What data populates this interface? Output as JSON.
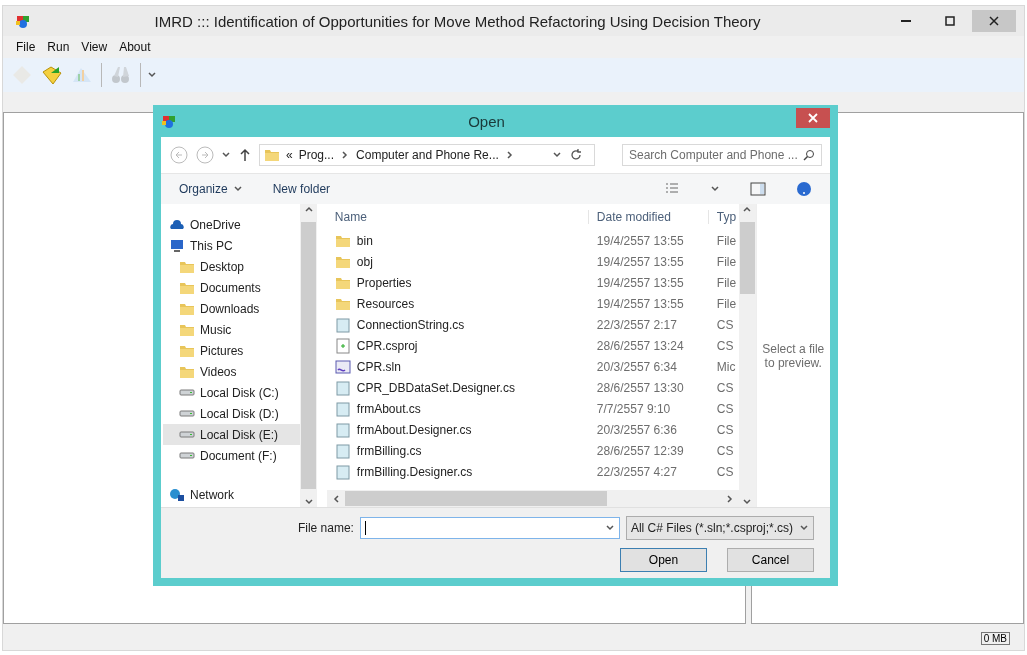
{
  "window": {
    "title": "IMRD ::: Identification of Opportunities for Move Method Refactoring Using Decision Theory"
  },
  "menu": [
    "File",
    "Run",
    "View",
    "About"
  ],
  "toolbar": [
    {
      "kind": "new",
      "disabled": true
    },
    {
      "kind": "open",
      "disabled": false
    },
    {
      "kind": "chart",
      "disabled": true
    },
    {
      "kind": "find",
      "disabled": true
    }
  ],
  "dialog": {
    "title": "Open",
    "address": {
      "prefix": "«",
      "crumbs": [
        "Prog...",
        "Computer and Phone Re..."
      ]
    },
    "search": {
      "placeholder": "Search Computer and Phone ..."
    },
    "commands": [
      "Organize",
      "New folder"
    ],
    "nav": [
      {
        "label": "OneDrive",
        "kind": "cloud",
        "selected": false
      },
      {
        "label": "This PC",
        "kind": "pc",
        "selected": false,
        "children": [
          {
            "label": "Desktop",
            "kind": "folder",
            "selected": false
          },
          {
            "label": "Documents",
            "kind": "folder",
            "selected": false
          },
          {
            "label": "Downloads",
            "kind": "folder",
            "selected": false
          },
          {
            "label": "Music",
            "kind": "folder",
            "selected": false
          },
          {
            "label": "Pictures",
            "kind": "folder",
            "selected": false
          },
          {
            "label": "Videos",
            "kind": "folder",
            "selected": false
          },
          {
            "label": "Local Disk (C:)",
            "kind": "drive",
            "selected": false
          },
          {
            "label": "Local Disk (D:)",
            "kind": "drive",
            "selected": false
          },
          {
            "label": "Local Disk (E:)",
            "kind": "drive",
            "selected": true
          },
          {
            "label": "Document (F:)",
            "kind": "drive",
            "selected": false
          }
        ]
      },
      {
        "label": "Network",
        "kind": "network",
        "selected": false
      }
    ],
    "columns": [
      "Name",
      "Date modified",
      "Typ"
    ],
    "files": [
      {
        "name": "bin",
        "date": "19/4/2557 13:55",
        "type": "File",
        "kind": "folder"
      },
      {
        "name": "obj",
        "date": "19/4/2557 13:55",
        "type": "File",
        "kind": "folder"
      },
      {
        "name": "Properties",
        "date": "19/4/2557 13:55",
        "type": "File",
        "kind": "folder"
      },
      {
        "name": "Resources",
        "date": "19/4/2557 13:55",
        "type": "File",
        "kind": "folder"
      },
      {
        "name": "ConnectionString.cs",
        "date": "22/3/2557 2:17",
        "type": "CS",
        "kind": "cs"
      },
      {
        "name": "CPR.csproj",
        "date": "28/6/2557 13:24",
        "type": "CS",
        "kind": "csproj"
      },
      {
        "name": "CPR.sln",
        "date": "20/3/2557 6:34",
        "type": "Mic",
        "kind": "sln"
      },
      {
        "name": "CPR_DBDataSet.Designer.cs",
        "date": "28/6/2557 13:30",
        "type": "CS",
        "kind": "cs"
      },
      {
        "name": "frmAbout.cs",
        "date": "7/7/2557 9:10",
        "type": "CS",
        "kind": "cs"
      },
      {
        "name": "frmAbout.Designer.cs",
        "date": "20/3/2557 6:36",
        "type": "CS",
        "kind": "cs"
      },
      {
        "name": "frmBilling.cs",
        "date": "28/6/2557 12:39",
        "type": "CS",
        "kind": "cs"
      },
      {
        "name": "frmBilling.Designer.cs",
        "date": "22/3/2557 4:27",
        "type": "CS",
        "kind": "cs"
      }
    ],
    "preview": "Select a file to preview.",
    "file_name": {
      "label": "File name:"
    },
    "filter": "All C# Files (*.sln;*.csproj;*.cs)",
    "buttons": [
      {
        "label": "Open",
        "kind": "default"
      },
      {
        "label": "Cancel",
        "kind": "normal"
      }
    ]
  },
  "status_bar": {
    "memory": "0 MB"
  }
}
